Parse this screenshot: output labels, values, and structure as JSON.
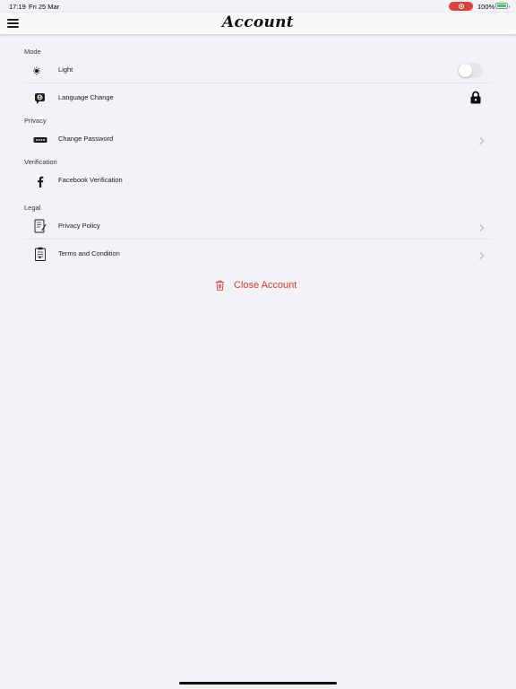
{
  "status_bar": {
    "time": "17:19",
    "date": "Fri 25 Mar",
    "battery": "100%",
    "battery_level": 1.0
  },
  "nav": {
    "title": "Account"
  },
  "sections": {
    "mode": {
      "header": "Mode",
      "light_label": "Light",
      "light_toggle_on": false,
      "language_label": "Language Change"
    },
    "privacy": {
      "header": "Privacy",
      "change_password_label": "Change Password"
    },
    "verification": {
      "header": "Verification",
      "facebook_label": "Facebook Verification"
    },
    "legal": {
      "header": "Legal",
      "privacy_policy_label": "Privacy Policy",
      "terms_label": "Terms and Condition"
    }
  },
  "close_account": {
    "label": "Close Account",
    "color": "#d93a32"
  },
  "icons": {
    "light": "sun-moon-icon",
    "language": "language-chat-icon",
    "lock": "lock-icon",
    "password": "password-dots-icon",
    "facebook": "facebook-icon",
    "privacy_policy": "document-pen-icon",
    "terms": "clipboard-icon",
    "trash": "trash-icon"
  }
}
